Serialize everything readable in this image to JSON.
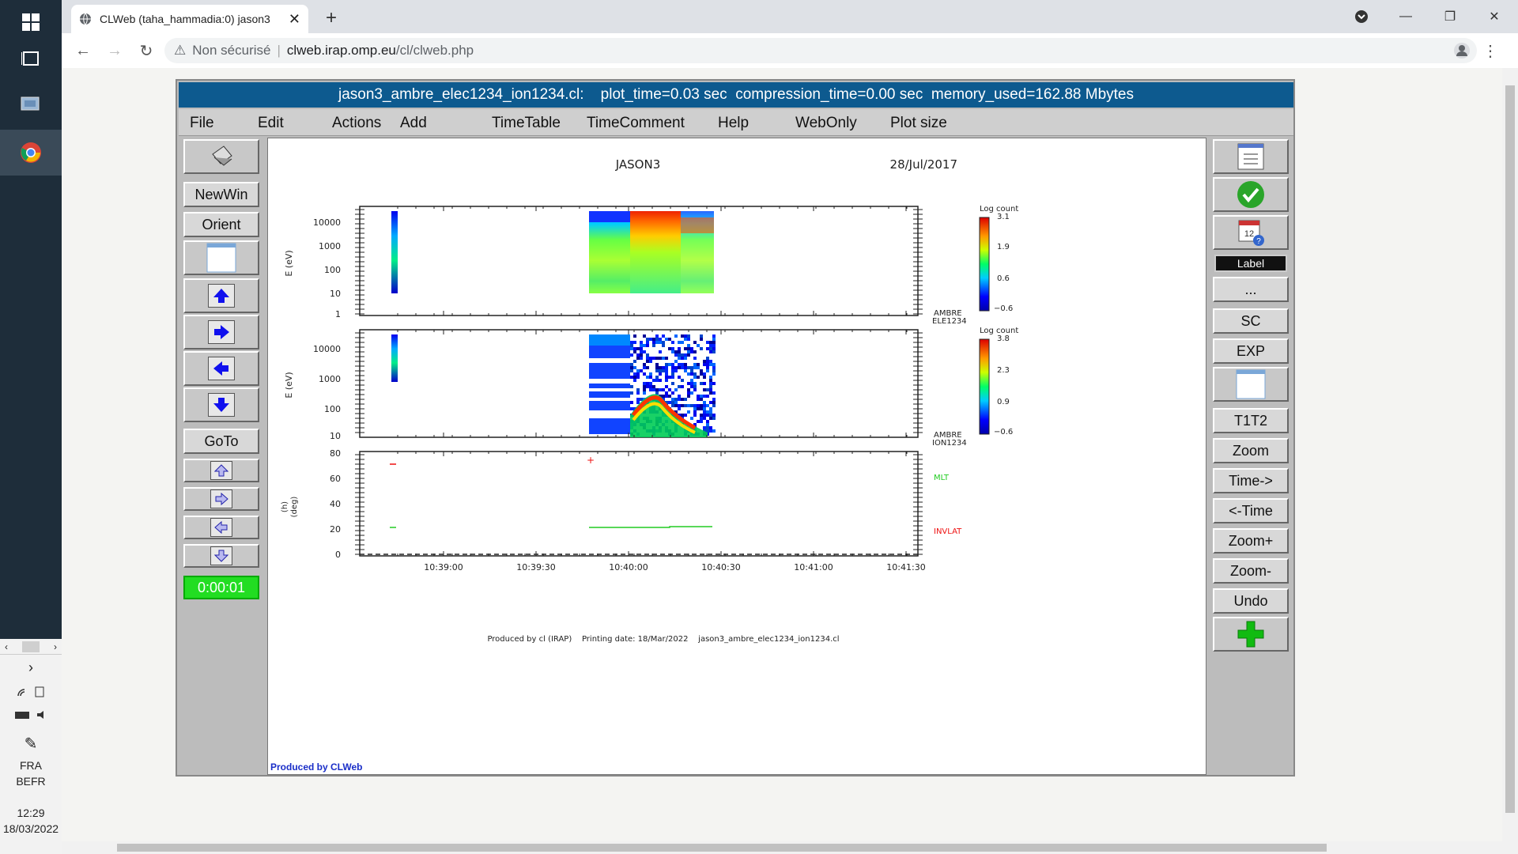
{
  "taskbar": {
    "lang1": "FRA",
    "lang2": "BEFR",
    "time": "12:29",
    "date": "18/03/2022"
  },
  "browser": {
    "tab_title": "CLWeb (taha_hammadia:0) jason3",
    "security": "Non sécurisé",
    "url_host": "clweb.irap.omp.eu",
    "url_path": "/cl/clweb.php"
  },
  "app": {
    "title": "jason3_ambre_elec1234_ion1234.cl:    plot_time=0.03 sec  compression_time=0.00 sec  memory_used=162.88 Mbytes",
    "menu": [
      "File",
      "Edit",
      "Actions",
      "Add",
      "TimeTable",
      "TimeComment",
      "Help",
      "WebOnly",
      "Plot size"
    ],
    "left_buttons": {
      "newwin": "NewWin",
      "orient": "Orient",
      "goto": "GoTo",
      "timer": "0:00:01"
    },
    "right_buttons": {
      "label": "Label",
      "dots": "...",
      "sc": "SC",
      "exp": "EXP",
      "t1t2": "T1T2",
      "zoom": "Zoom",
      "time_fwd": "Time->",
      "time_back": "<-Time",
      "zoom_plus": "Zoom+",
      "zoom_minus": "Zoom-",
      "undo": "Undo"
    }
  },
  "plot": {
    "spacecraft": "JASON3",
    "date": "28/Jul/2017",
    "panel1": {
      "ylabel": "E (eV)",
      "yticks": [
        "10000",
        "1000",
        "100",
        "10",
        "1"
      ],
      "label1": "AMBRE",
      "label2": "ELE1234",
      "cbar_title": "Log count",
      "cbar_ticks": [
        "3.1",
        "1.9",
        "0.6",
        "−0.6"
      ]
    },
    "panel2": {
      "ylabel": "E (eV)",
      "yticks": [
        "10000",
        "1000",
        "100",
        "10"
      ],
      "label1": "AMBRE",
      "label2": "ION1234",
      "cbar_title": "Log count",
      "cbar_ticks": [
        "3.8",
        "2.3",
        "0.9",
        "−0.6"
      ]
    },
    "panel3": {
      "ylabel1": "(h)",
      "ylabel2": "(deg)",
      "yticks": [
        "80",
        "60",
        "40",
        "20",
        "0"
      ],
      "mlt_label": "MLT",
      "invlat_label": "INVLAT",
      "mlt_color": "#22cc22",
      "invlat_color": "#ee1111"
    },
    "xticks": [
      "10:39:00",
      "10:39:30",
      "10:40:00",
      "10:40:30",
      "10:41:00",
      "10:41:30"
    ],
    "footer": "Produced by cl (IRAP)    Printing date: 18/Mar/2022    jason3_ambre_elec1234_ion1234.cl",
    "produced_by": "Produced by CLWeb"
  }
}
